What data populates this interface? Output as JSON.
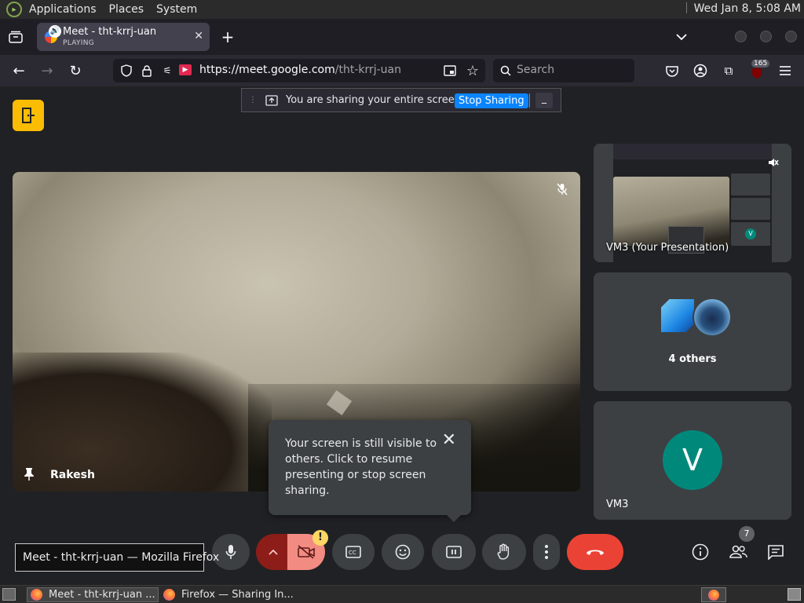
{
  "top_panel": {
    "menus": [
      "Applications",
      "Places",
      "System"
    ],
    "clock": "Wed Jan  8,  5:08 AM"
  },
  "browser": {
    "tab": {
      "title": "Meet - tht-krrj-uan",
      "subtitle": "PLAYING"
    },
    "url": {
      "host": "https://meet.google.com",
      "path": "/tht-krrj-uan"
    },
    "search_placeholder": "Search",
    "extension_badge": "165"
  },
  "share_bar": {
    "message": "You are sharing your entire screen.",
    "stop_label": "Stop Sharing",
    "hide_label": "_"
  },
  "meet": {
    "main_participant": {
      "name": "Rakesh"
    },
    "tiles": [
      {
        "label": "VM3 (Your Presentation)"
      },
      {
        "label": "4 others"
      },
      {
        "label": "VM3",
        "avatar_letter": "V",
        "avatar_color": "#00897b"
      }
    ],
    "popup": {
      "text": "Your screen is still visible to others. Click to resume presenting or stop screen sharing."
    },
    "controls": {
      "warning": "!",
      "participants_count": "7"
    },
    "tooltip": "Meet - tht-krrj-uan — Mozilla Firefox"
  },
  "taskbar": {
    "items": [
      "Meet - tht-krrj-uan ...",
      "Firefox — Sharing In..."
    ]
  },
  "colors": {
    "meet_bg": "#202124",
    "tile_bg": "#3c4043",
    "end_call": "#ea4335",
    "stop_sharing": "#0a84ff",
    "meet_logo": "#fbbc04"
  }
}
